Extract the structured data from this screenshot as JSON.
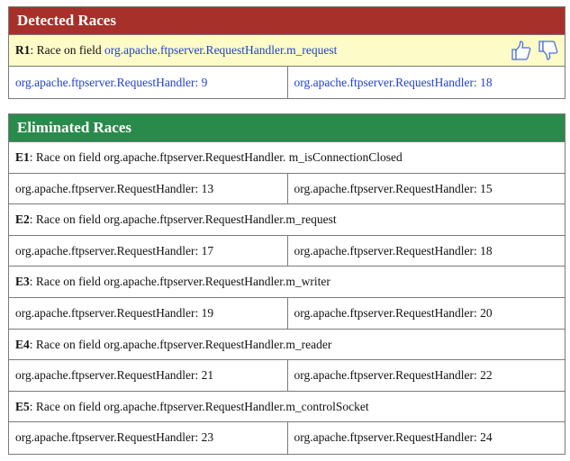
{
  "detected": {
    "title": "Detected Races",
    "race": {
      "id": "R1",
      "prefix": ": Race on field ",
      "field": "org.apache.ftpserver.RequestHandler.m_request",
      "loc1": "org.apache.ftpserver.RequestHandler: 9",
      "loc2": "org.apache.ftpserver.RequestHandler: 18"
    },
    "icons": [
      "thumbs-up-icon",
      "thumbs-down-icon"
    ]
  },
  "eliminated": {
    "title": "Eliminated Races",
    "races": [
      {
        "id": "E1",
        "text": ": Race on field org.apache.ftpserver.RequestHandler. m_isConnectionClosed",
        "loc1": "org.apache.ftpserver.RequestHandler: 13",
        "loc2": "org.apache.ftpserver.RequestHandler: 15"
      },
      {
        "id": "E2",
        "text": ": Race on field org.apache.ftpserver.RequestHandler.m_request",
        "loc1": "org.apache.ftpserver.RequestHandler: 17",
        "loc2": "org.apache.ftpserver.RequestHandler: 18"
      },
      {
        "id": "E3",
        "text": ": Race on field org.apache.ftpserver.RequestHandler.m_writer",
        "loc1": "org.apache.ftpserver.RequestHandler: 19",
        "loc2": "org.apache.ftpserver.RequestHandler: 20"
      },
      {
        "id": "E4",
        "text": ": Race on field org.apache.ftpserver.RequestHandler.m_reader",
        "loc1": "org.apache.ftpserver.RequestHandler: 21",
        "loc2": "org.apache.ftpserver.RequestHandler: 22"
      },
      {
        "id": "E5",
        "text": ": Race on field org.apache.ftpserver.RequestHandler.m_controlSocket",
        "loc1": "org.apache.ftpserver.RequestHandler: 23",
        "loc2": "org.apache.ftpserver.RequestHandler: 24"
      }
    ]
  },
  "colors": {
    "detected_header": "#a8302b",
    "eliminated_header": "#2a8a4c",
    "highlight": "#fdfbc7",
    "link": "#1f3fd6"
  }
}
